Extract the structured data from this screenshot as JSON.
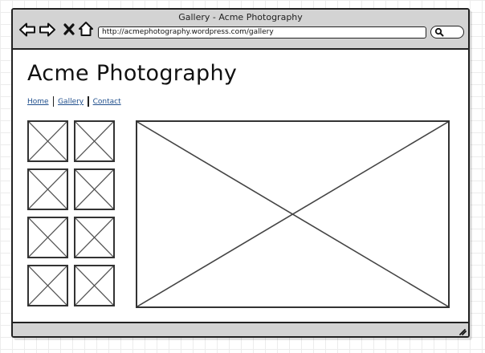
{
  "window": {
    "title": "Gallery - Acme Photography",
    "url": "http://acmephotography.wordpress.com/gallery"
  },
  "icons": {
    "back": "back-arrow-icon",
    "forward": "forward-arrow-icon",
    "stop": "close-icon",
    "home": "home-icon",
    "search": "search-icon",
    "image_placeholder": "image-placeholder-icon",
    "resize": "resize-grip-icon"
  },
  "page": {
    "site_title": "Acme Photography",
    "nav": [
      {
        "label": "Home"
      },
      {
        "label": "Gallery"
      },
      {
        "label": "Contact"
      }
    ]
  },
  "gallery": {
    "thumbnail_count": 8,
    "layout": "2 columns x 4 rows"
  },
  "colors": {
    "chrome": "#d3d3d3",
    "outline": "#222222",
    "link": "#1f4e8c"
  }
}
